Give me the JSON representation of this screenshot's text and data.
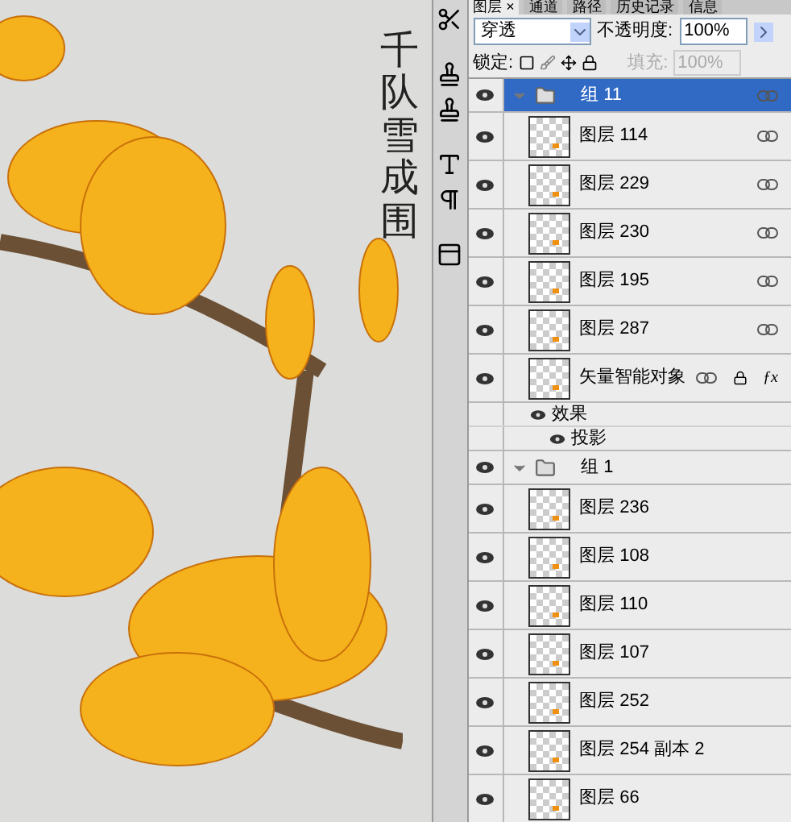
{
  "artwork": {
    "vertical_text": "千队雪成围"
  },
  "tabs": [
    {
      "label": "图层",
      "selected": true,
      "close": "×"
    },
    {
      "label": "通道",
      "selected": false
    },
    {
      "label": "路径",
      "selected": false
    },
    {
      "label": "历史记录",
      "selected": false
    },
    {
      "label": "信息",
      "selected": false
    }
  ],
  "blend": {
    "value": "穿透",
    "opacity_label": "不透明度:",
    "opacity": "100%"
  },
  "lock": {
    "label": "锁定:",
    "fill_label": "填充:",
    "fill": "100%",
    "fill_disabled": true
  },
  "layers": [
    {
      "kind": "group",
      "name": "组 11",
      "visible": true,
      "selected": true,
      "expanded": true,
      "linked": true,
      "children": [
        {
          "kind": "layer",
          "name": "图层 114",
          "visible": true,
          "selected": false,
          "linked": true
        },
        {
          "kind": "layer",
          "name": "图层 229",
          "visible": true,
          "selected": false,
          "linked": true
        },
        {
          "kind": "layer",
          "name": "图层 230",
          "visible": true,
          "selected": false,
          "linked": true
        },
        {
          "kind": "layer",
          "name": "图层 195",
          "visible": true,
          "selected": false,
          "linked": true
        },
        {
          "kind": "layer",
          "name": "图层 287",
          "visible": true,
          "selected": false,
          "linked": true
        },
        {
          "kind": "smart",
          "name": "矢量智能对象",
          "visible": true,
          "selected": false,
          "linked": true,
          "fx": "ƒx",
          "effects_label": "效果",
          "effects": [
            "投影"
          ]
        }
      ]
    },
    {
      "kind": "group",
      "name": "组 1",
      "visible": true,
      "selected": false,
      "expanded": true,
      "linked": false,
      "children": [
        {
          "kind": "layer",
          "name": "图层 236",
          "visible": true,
          "selected": false,
          "linked": false
        },
        {
          "kind": "layer",
          "name": "图层 108",
          "visible": true,
          "selected": false,
          "linked": false
        },
        {
          "kind": "layer",
          "name": "图层 110",
          "visible": true,
          "selected": false,
          "linked": false
        },
        {
          "kind": "layer",
          "name": "图层 107",
          "visible": true,
          "selected": false,
          "linked": false
        },
        {
          "kind": "layer",
          "name": "图层 252",
          "visible": true,
          "selected": false,
          "linked": false
        },
        {
          "kind": "layer",
          "name": "图层 254 副本 2",
          "visible": true,
          "selected": false,
          "linked": false
        },
        {
          "kind": "layer",
          "name": "图层 66",
          "visible": true,
          "selected": false,
          "linked": false
        }
      ]
    }
  ]
}
